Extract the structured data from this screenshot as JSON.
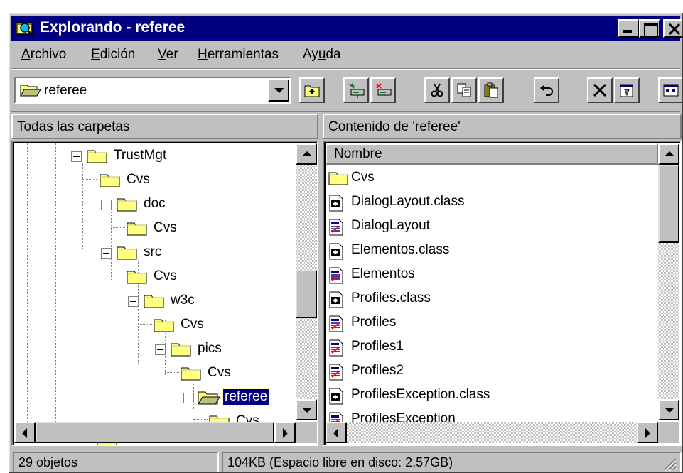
{
  "window": {
    "title": "Explorando - referee",
    "controls": [
      "minimize",
      "maximize",
      "close"
    ]
  },
  "menubar": {
    "items": [
      {
        "label": "Archivo",
        "accel": "A"
      },
      {
        "label": "Edición",
        "accel": "E"
      },
      {
        "label": "Ver",
        "accel": "V"
      },
      {
        "label": "Herramientas",
        "accel": "H"
      },
      {
        "label": "Ayuda",
        "accel": "u"
      }
    ]
  },
  "toolbar": {
    "address": "referee",
    "buttons": [
      "up-one-level",
      "map-network-drive",
      "disconnect-network-drive",
      "cut",
      "copy",
      "paste",
      "undo",
      "delete",
      "properties",
      "view-large-icons"
    ]
  },
  "left_pane": {
    "header": "Todas las carpetas",
    "tree": [
      {
        "label": "TrustMgt",
        "depth": 0,
        "expanded": true
      },
      {
        "label": "Cvs",
        "depth": 1
      },
      {
        "label": "doc",
        "depth": 1,
        "expanded": true
      },
      {
        "label": "Cvs",
        "depth": 2
      },
      {
        "label": "src",
        "depth": 1,
        "expanded": true
      },
      {
        "label": "Cvs",
        "depth": 2
      },
      {
        "label": "w3c",
        "depth": 2,
        "expanded": true
      },
      {
        "label": "Cvs",
        "depth": 3
      },
      {
        "label": "pics",
        "depth": 3,
        "expanded": true
      },
      {
        "label": "Cvs",
        "depth": 4
      },
      {
        "label": "referee",
        "depth": 4,
        "expanded": true,
        "selected": true
      },
      {
        "label": "Cvs",
        "depth": 5
      }
    ]
  },
  "right_pane": {
    "header": "Contenido de 'referee'",
    "column": "Nombre",
    "files": [
      {
        "name": "Cvs",
        "type": "folder"
      },
      {
        "name": "DialogLayout.class",
        "type": "class"
      },
      {
        "name": "DialogLayout",
        "type": "java"
      },
      {
        "name": "Elementos.class",
        "type": "class"
      },
      {
        "name": "Elementos",
        "type": "java"
      },
      {
        "name": "Profiles.class",
        "type": "class"
      },
      {
        "name": "Profiles",
        "type": "java"
      },
      {
        "name": "Profiles1",
        "type": "java"
      },
      {
        "name": "Profiles2",
        "type": "java"
      },
      {
        "name": "ProfilesException.class",
        "type": "class"
      },
      {
        "name": "ProfilesException",
        "type": "java"
      }
    ]
  },
  "statusbar": {
    "count": "29 objetos",
    "size": "104KB (Espacio libre en disco: 2,57GB)"
  }
}
